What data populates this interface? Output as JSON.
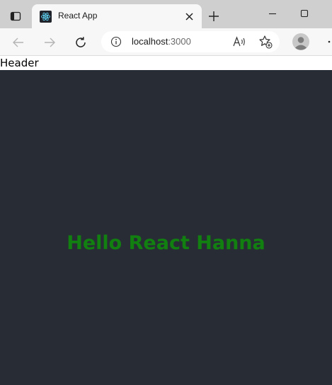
{
  "browser": {
    "tab": {
      "title": "React App"
    },
    "address_bar": {
      "host": "localhost",
      "port": ":3000"
    }
  },
  "page": {
    "header_text": "Header",
    "heading": "Hello React Hanna"
  },
  "icons": {
    "tab_actions": "tab-actions-icon",
    "favicon": "react-logo-icon",
    "close": "close-icon",
    "new_tab": "plus-icon",
    "minimize": "minimize-icon",
    "maximize": "maximize-icon",
    "back": "arrow-left-icon",
    "forward": "arrow-right-icon",
    "reload": "reload-icon",
    "site_info": "info-icon",
    "read_aloud": "read-aloud-icon",
    "favorites": "star-plus-icon",
    "profile": "avatar-icon",
    "more": "more-icon"
  },
  "colors": {
    "app_background": "#282c34",
    "heading": "#118011",
    "tabstrip": "#cfcfcf",
    "toolbar": "#f7f7f7"
  }
}
